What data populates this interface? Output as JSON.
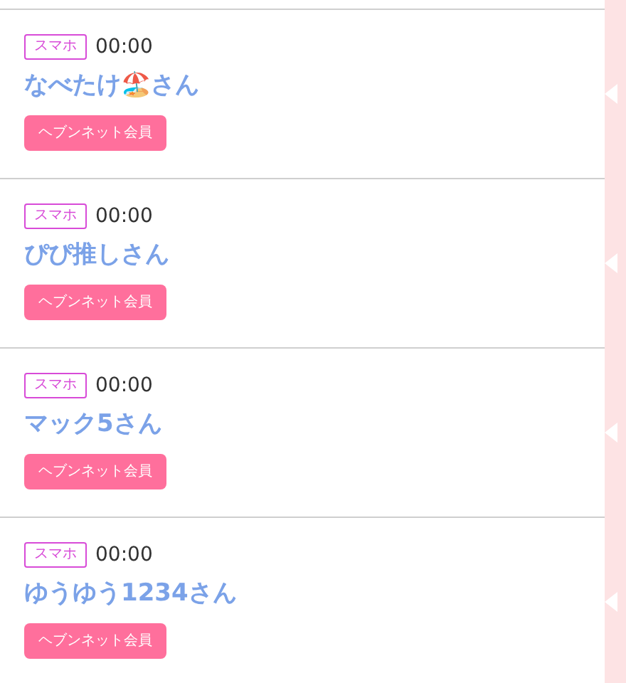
{
  "entries": [
    {
      "device": "スマホ",
      "time": "00:00",
      "name": "なべたけ🏖️さん",
      "badge": "ヘブンネット会員"
    },
    {
      "device": "スマホ",
      "time": "00:00",
      "name": "ぴぴ推しさん",
      "badge": "ヘブンネット会員"
    },
    {
      "device": "スマホ",
      "time": "00:00",
      "name": "マック5さん",
      "badge": "ヘブンネット会員"
    },
    {
      "device": "スマホ",
      "time": "00:00",
      "name": "ゆうゆう1234さん",
      "badge": "ヘブンネット会員"
    }
  ]
}
